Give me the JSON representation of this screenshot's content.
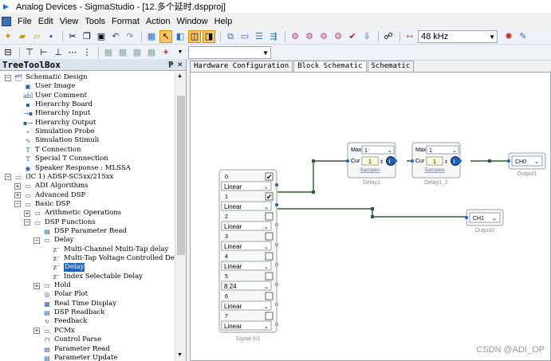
{
  "window": {
    "title": "Analog Devices - SigmaStudio - [12.多个延时.dspproj]"
  },
  "menu": [
    "File",
    "Edit",
    "View",
    "Tools",
    "Format",
    "Action",
    "Window",
    "Help"
  ],
  "toolbar": {
    "sample_rate": "48 kHz"
  },
  "toolbox": {
    "title": "TreeToolBox",
    "pin": "ᵽ",
    "close": "✕",
    "items": [
      {
        "label": "Schematic Design",
        "exp": "⊟",
        "icon": "🗂"
      },
      {
        "label": "User Image",
        "icon": "▣"
      },
      {
        "label": "User Comment",
        "icon": "abl"
      },
      {
        "label": "Hierarchy Board",
        "icon": "▪"
      },
      {
        "label": "Hierarchy Input",
        "icon": "→▪"
      },
      {
        "label": "Hierarchy Output",
        "icon": "▪→"
      },
      {
        "label": "Simulation Probe",
        "icon": "⌁"
      },
      {
        "label": "Simulation Stimuli",
        "icon": "∿"
      },
      {
        "label": "T Connection",
        "icon": "T"
      },
      {
        "label": "Special T Connection",
        "icon": "T"
      },
      {
        "label": "Speaker Response : MLSSA",
        "icon": "◉"
      },
      {
        "label": "(IC 1) ADSP-SC5xx/215xx",
        "exp": "⊟",
        "icon": "▭"
      },
      {
        "label": "ADI Algorithms",
        "exp": "⊞",
        "icon": "▭"
      },
      {
        "label": "Advanced DSP",
        "exp": "⊞",
        "icon": "▭"
      },
      {
        "label": "Basic DSP",
        "exp": "⊟",
        "icon": "▭"
      },
      {
        "label": "Arithmetic Operations",
        "exp": "⊞",
        "icon": "▭"
      },
      {
        "label": "DSP Functions",
        "exp": "⊟",
        "icon": "▭"
      },
      {
        "label": "DSP Parameter Read",
        "icon": "▤"
      },
      {
        "label": "Delay",
        "exp": "⊟",
        "icon": "▭"
      },
      {
        "label": "Multi-Channel Multi-Tap delay",
        "icon": "z⁻"
      },
      {
        "label": "Multi-Tap Voltage Controlled Del",
        "icon": "z⁻"
      },
      {
        "label": "Delay",
        "icon": "z⁻",
        "selected": true
      },
      {
        "label": "Index Selectable Delay",
        "icon": "z⁻"
      },
      {
        "label": "Hold",
        "exp": "⊞",
        "icon": "▭"
      },
      {
        "label": "Polar Plot",
        "icon": "◎"
      },
      {
        "label": "Real Time Display",
        "icon": "▦"
      },
      {
        "label": "DSP Readback",
        "icon": "▤"
      },
      {
        "label": "Feedback",
        "icon": "↻"
      },
      {
        "label": "PCMx",
        "exp": "⊞",
        "icon": "▭"
      },
      {
        "label": "Control Parse",
        "icon": "⊓"
      },
      {
        "label": "Parameter Read",
        "icon": "▤"
      },
      {
        "label": "Parameter Update",
        "icon": "▤"
      }
    ]
  },
  "tabs": [
    "Hardware Configuration",
    "Block Schematic",
    "Schematic"
  ],
  "schematic": {
    "input_block": {
      "label": "Signal In1",
      "channels": [
        {
          "num": "0",
          "checked": true,
          "mode": "Linear"
        },
        {
          "num": "1",
          "checked": true,
          "mode": "Linear"
        },
        {
          "num": "2",
          "checked": false,
          "mode": "Linear"
        },
        {
          "num": "3",
          "checked": false,
          "mode": "Linear"
        },
        {
          "num": "4",
          "checked": false,
          "mode": "Linear"
        },
        {
          "num": "5",
          "checked": false,
          "mode": "8.24"
        },
        {
          "num": "6",
          "checked": false,
          "mode": "Linear"
        },
        {
          "num": "7",
          "checked": false,
          "mode": "Linear"
        }
      ]
    },
    "delay1": {
      "max": "Max",
      "max_val": "1",
      "cur": "Cur",
      "cur_val": "1",
      "unit": "Samples",
      "label": "Delay1"
    },
    "delay2": {
      "max": "Max",
      "max_val": "1",
      "cur": "Cur",
      "cur_val": "1",
      "unit": "Samples",
      "label": "Delay1_2"
    },
    "output1": {
      "ch": "CH0",
      "label": "Output1"
    },
    "output2": {
      "ch": "CH1",
      "label": "Output2"
    }
  },
  "watermark": "CSDN @ADI_OP",
  "colors": {
    "wire": "#2e5d2e",
    "selection": "#1c64c8",
    "block_border": "#9aa3ad",
    "info_icon": "#1f5fbf"
  }
}
